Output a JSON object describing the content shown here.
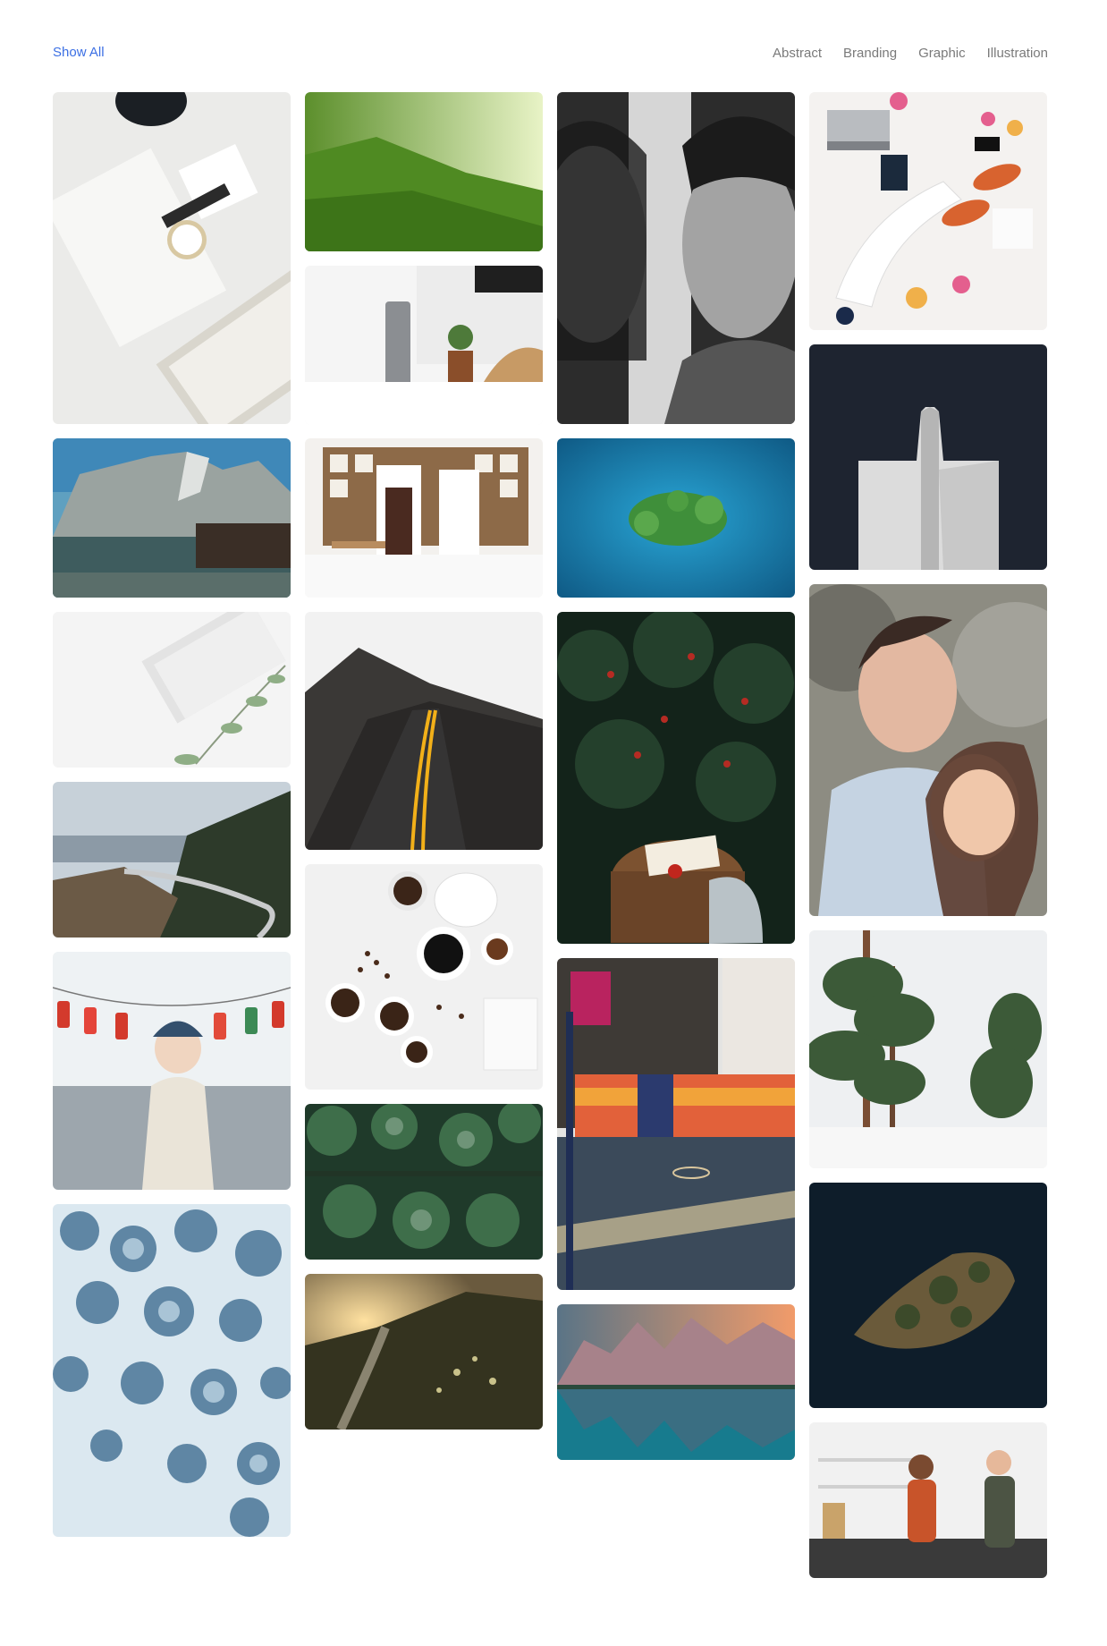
{
  "filters": {
    "show_all": "Show All",
    "categories": [
      "Abstract",
      "Branding",
      "Graphic",
      "Illustration"
    ]
  },
  "gallery": {
    "tiles": [
      {
        "name": "desk-watch-keyboard-image"
      },
      {
        "name": "green-tea-hills-image"
      },
      {
        "name": "speaker-desk-image"
      },
      {
        "name": "bw-couple-portrait-image"
      },
      {
        "name": "flatlay-sneakers-image"
      },
      {
        "name": "mountain-lake-cabin-image"
      },
      {
        "name": "bookshelf-interior-image"
      },
      {
        "name": "aerial-island-blue-image"
      },
      {
        "name": "dark-tower-architecture-image"
      },
      {
        "name": "envelope-eucalyptus-image"
      },
      {
        "name": "winding-road-image"
      },
      {
        "name": "apple-tree-book-image"
      },
      {
        "name": "smiling-couple-image"
      },
      {
        "name": "mountain-viaduct-image"
      },
      {
        "name": "coffee-beans-flatlay-image"
      },
      {
        "name": "snowy-pine-trees-image"
      },
      {
        "name": "woman-christmas-socks-image"
      },
      {
        "name": "aerial-pine-forest-image"
      },
      {
        "name": "colorful-basketball-court-image"
      },
      {
        "name": "dark-aerial-island-image"
      },
      {
        "name": "snowy-forest-aerial-image"
      },
      {
        "name": "sunset-trail-image"
      },
      {
        "name": "lake-mountain-reflection-image"
      },
      {
        "name": "kitchen-couple-image"
      }
    ]
  }
}
